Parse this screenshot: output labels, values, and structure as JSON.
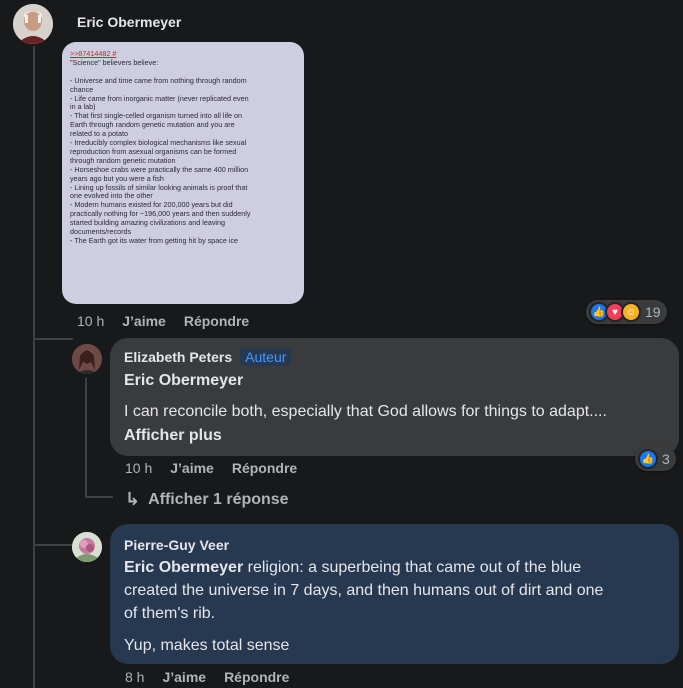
{
  "top_comment": {
    "author": "Eric Obermeyer",
    "image_text": {
      "ref": ">>87414482 #",
      "lines": [
        "\"Science\" believers believe:",
        "",
        "- Universe and time came from nothing through random",
        "chance",
        "- Life came from inorganic matter (never replicated even",
        "in a lab)",
        "- That first single-celled organism turned into all life on",
        "Earth through random genetic mutation and you are",
        "related to a potato",
        "- Irreducibly complex biological mechanisms like sexual",
        "reproduction from asexual organisms can be formed",
        "through random genetic mutation",
        "- Horseshoe crabs were practically the same 400 million",
        "years ago but you were a fish",
        "- Lining up fossils of similar looking animals is proof that",
        "one evolved into the other",
        "- Modern humans existed for 200,000 years but did",
        "practically nothing for ~196,000 years and then suddenly",
        "started building amazing civilizations and leaving",
        "documents/records",
        "- The Earth got its water from getting hit by space ice"
      ]
    },
    "time": "10 h",
    "like_label": "J’aime",
    "reply_label": "Répondre",
    "reaction_count": "19"
  },
  "reply1": {
    "author": "Elizabeth Peters",
    "badge": "Auteur",
    "mention": "Eric Obermeyer",
    "text": "I can reconcile both, especially that God allows for things to adapt....",
    "more": "Afficher plus",
    "time": "10 h",
    "like_label": "J’aime",
    "reply_label": "Répondre",
    "reaction_count": "3",
    "view_replies": "Afficher 1 réponse"
  },
  "reply2": {
    "author": "Pierre-Guy Veer",
    "mention": "Eric Obermeyer",
    "text_line1": " religion: a superbeing that came out of the blue",
    "text_line2": "created the universe in 7 days, and then humans out of dirt and one",
    "text_line3": "of them's rib.",
    "text_line4": "Yup, makes total sense",
    "time": "8 h",
    "like_label": "J’aime",
    "reply_label": "Répondre"
  },
  "colors": {
    "background": "#18191a",
    "bubble_gray": "#3a3b3c",
    "bubble_blue": "#263951",
    "accent": "#2d88ff"
  }
}
